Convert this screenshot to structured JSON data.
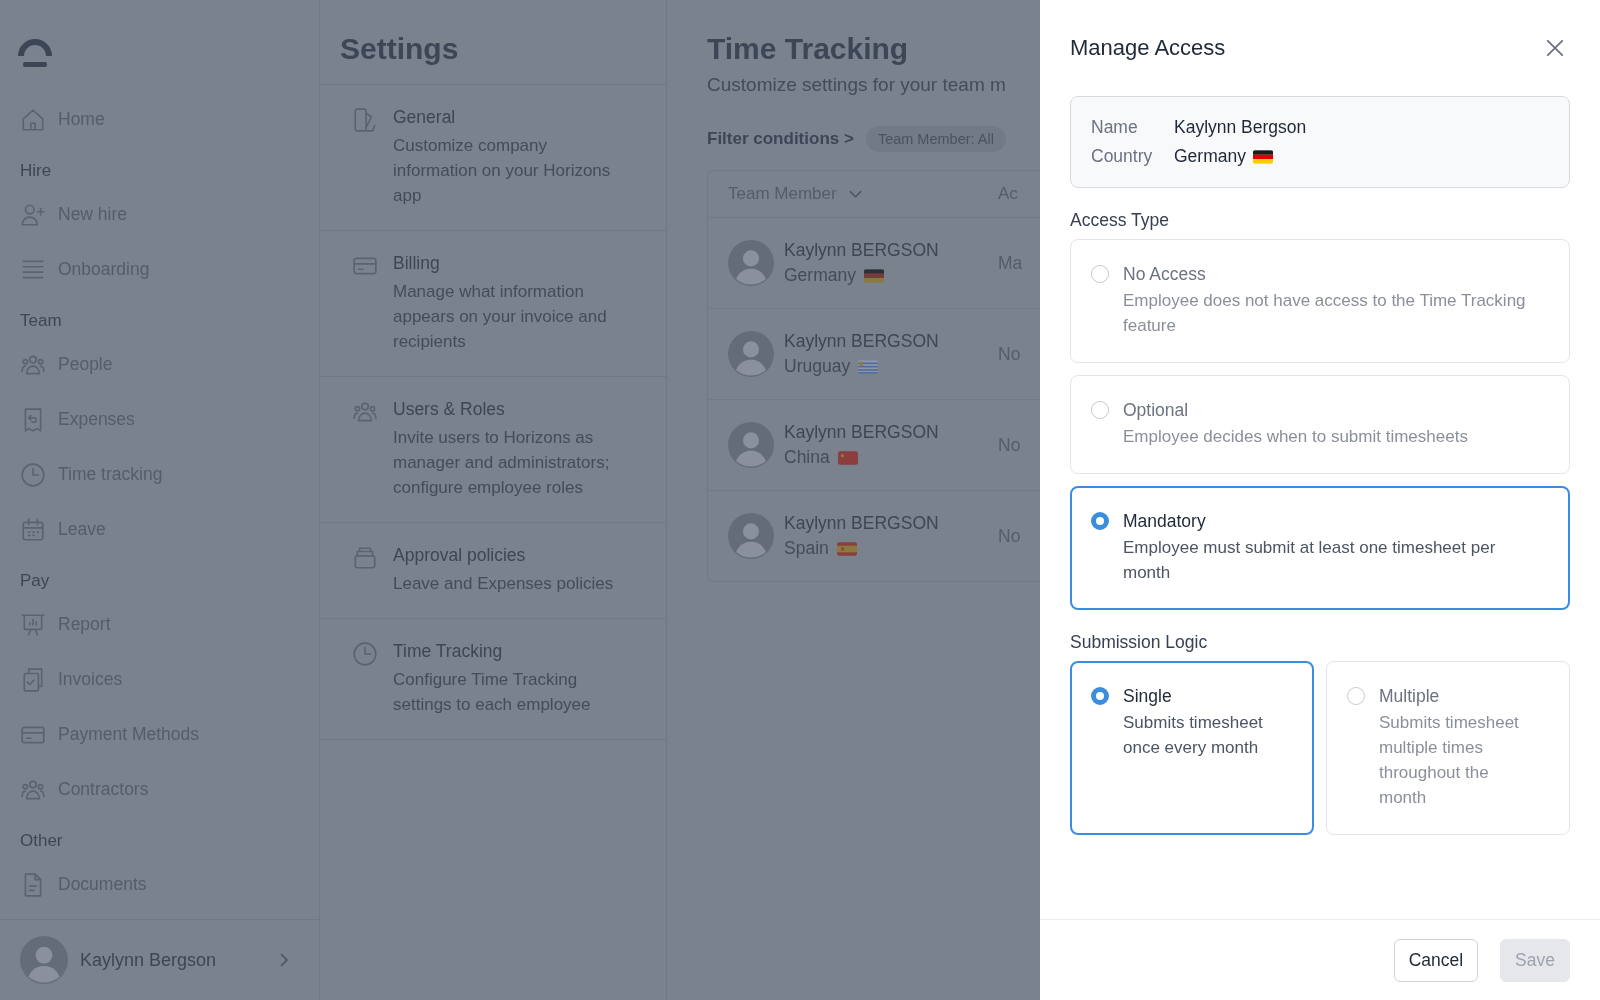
{
  "sidebar": {
    "groups": [
      {
        "items": [
          "Home"
        ]
      },
      {
        "label": "Hire",
        "items": [
          "New hire",
          "Onboarding"
        ]
      },
      {
        "label": "Team",
        "items": [
          "People",
          "Expenses",
          "Time tracking",
          "Leave"
        ]
      },
      {
        "label": "Pay",
        "items": [
          "Report",
          "Invoices",
          "Payment Methods",
          "Contractors"
        ]
      },
      {
        "label": "Other",
        "items": [
          "Documents"
        ]
      }
    ],
    "user": {
      "name": "Kaylynn Bergson"
    }
  },
  "settings": {
    "title": "Settings",
    "items": [
      {
        "title": "General",
        "description": "Customize company information on your Horizons app"
      },
      {
        "title": "Billing",
        "description": "Manage what information appears on your invoice and recipients"
      },
      {
        "title": "Users & Roles",
        "description": "Invite users to Horizons as manager and administrators; configure employee roles"
      },
      {
        "title": "Approval policies",
        "description": "Leave and Expenses policies"
      },
      {
        "title": "Time Tracking",
        "description": "Configure Time Tracking settings to each employee"
      }
    ]
  },
  "time_tracking": {
    "title": "Time Tracking",
    "subtitle": "Customize settings for your team m",
    "filter_label": "Filter conditions >",
    "filter_chip": "Team Member: All",
    "table": {
      "columns": [
        "Team Member",
        "Ac"
      ],
      "rows": [
        {
          "name": "Kaylynn BERGSON",
          "country": "Germany",
          "column_2": "Ma"
        },
        {
          "name": "Kaylynn BERGSON",
          "country": "Uruguay",
          "column_2": "No"
        },
        {
          "name": "Kaylynn BERGSON",
          "country": "China",
          "column_2": "No"
        },
        {
          "name": "Kaylynn BERGSON",
          "country": "Spain",
          "column_2": "No"
        }
      ]
    }
  },
  "drawer": {
    "title": "Manage Access",
    "info": [
      {
        "label": "Name",
        "value": "Kaylynn Bergson"
      },
      {
        "label": "Country",
        "value": "Germany"
      }
    ],
    "access_type": {
      "label": "Access Type",
      "options": [
        {
          "title": "No Access",
          "description": "Employee does not have access to the Time Tracking feature",
          "selected": false
        },
        {
          "title": "Optional",
          "description": "Employee decides when to submit timesheets",
          "selected": false
        },
        {
          "title": "Mandatory",
          "description": "Employee must submit at least one timesheet per month",
          "selected": true
        }
      ]
    },
    "submission_logic": {
      "label": "Submission Logic",
      "options": [
        {
          "title": "Single",
          "description": "Submits timesheet once every month",
          "selected": true
        },
        {
          "title": "Multiple",
          "description": "Submits timesheet multiple times throughout the month",
          "selected": false
        }
      ]
    },
    "buttons": [
      {
        "label": "Cancel",
        "disabled": false
      },
      {
        "label": "Save",
        "disabled": true
      }
    ]
  }
}
